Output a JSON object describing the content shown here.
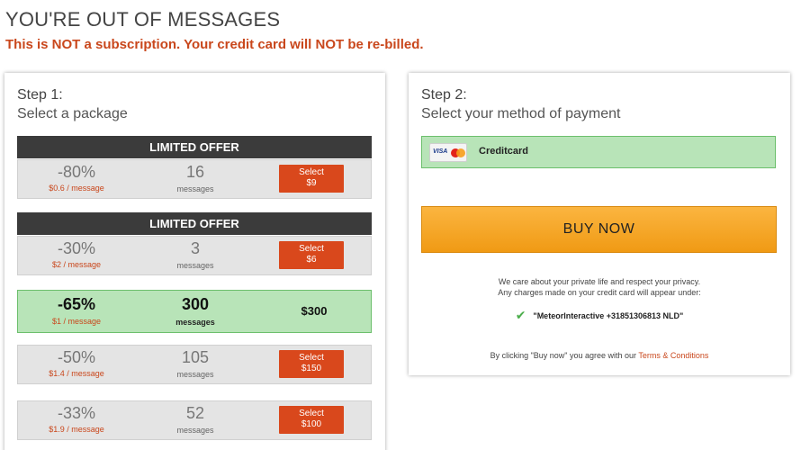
{
  "header": {
    "title": "YOU'RE OUT OF MESSAGES",
    "notice": "This is NOT a subscription. Your credit card will NOT be re-billed."
  },
  "step1": {
    "step_label": "Step 1:",
    "subtitle": "Select a package",
    "packages": [
      {
        "banner": "LIMITED OFFER",
        "discount": "-80%",
        "price_per_message": "$0.6 / message",
        "count": "16",
        "count_label": "messages",
        "button_line1": "Select",
        "button_line2": "$9"
      },
      {
        "banner": "LIMITED OFFER",
        "discount": "-30%",
        "price_per_message": "$2 / message",
        "count": "3",
        "count_label": "messages",
        "button_line1": "Select",
        "button_line2": "$6"
      },
      {
        "discount": "-65%",
        "price_per_message": "$1 / message",
        "count": "300",
        "count_label": "messages",
        "price": "$300",
        "selected": true
      },
      {
        "discount": "-50%",
        "price_per_message": "$1.4 / message",
        "count": "105",
        "count_label": "messages",
        "button_line1": "Select",
        "button_line2": "$150"
      },
      {
        "discount": "-33%",
        "price_per_message": "$1.9 / message",
        "count": "52",
        "count_label": "messages",
        "button_line1": "Select",
        "button_line2": "$100"
      }
    ]
  },
  "step2": {
    "step_label": "Step 2:",
    "subtitle": "Select your method of payment",
    "payment_method": {
      "card_brand": "VISA",
      "label": "Creditcard"
    },
    "buy_label": "BUY NOW",
    "privacy_line1": "We care about your private life and respect your privacy.",
    "privacy_line2": "Any charges made on your credit card will appear under:",
    "descriptor": "\"MeteorInteractive +31851306813 NLD\"",
    "terms_prefix": "By clicking \"Buy now\" you agree with our ",
    "terms_link": "Terms & Conditions"
  },
  "colors": {
    "accent_red": "#d9481c",
    "selected_green": "#b8e4b8",
    "buy_orange": "#f5a623",
    "banner_dark": "#3b3b3b"
  }
}
